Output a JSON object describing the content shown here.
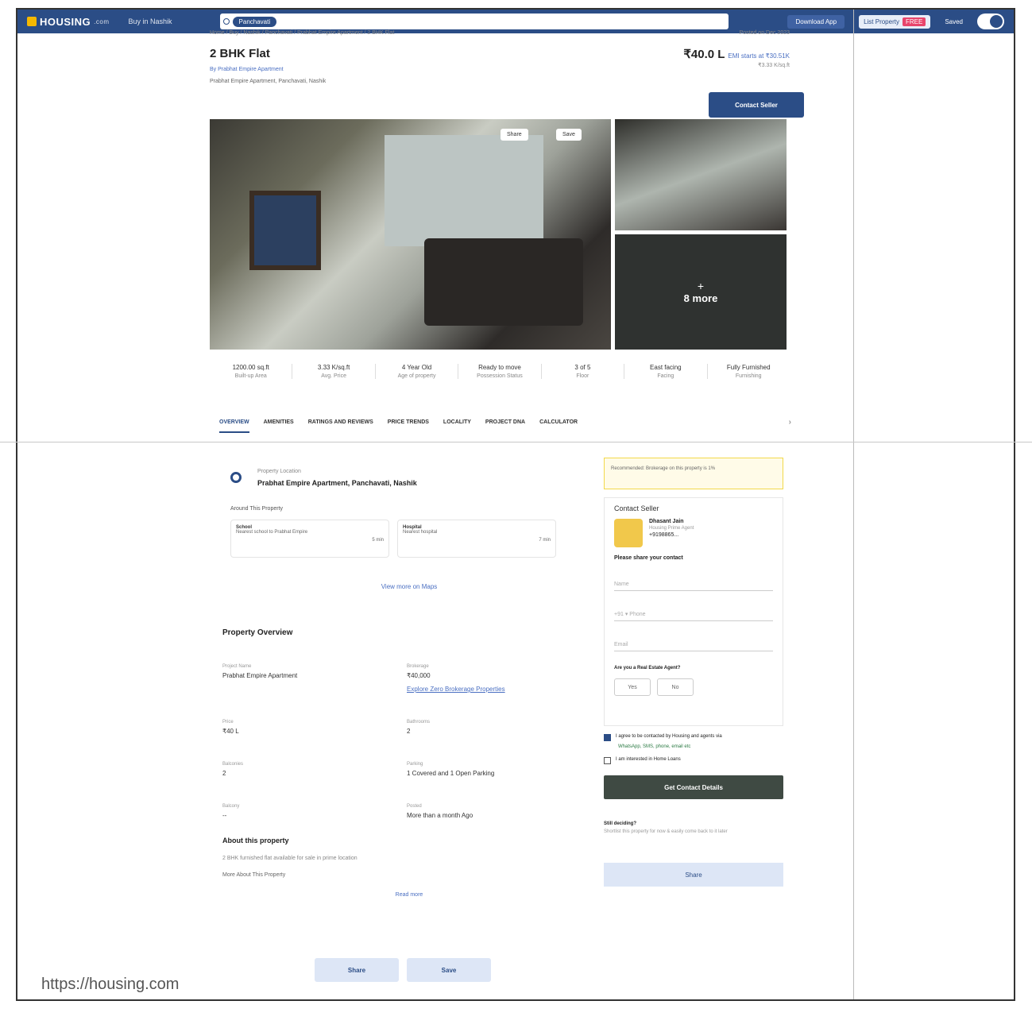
{
  "header": {
    "logo": "HOUSING",
    "logo_suffix": ".com",
    "buy_menu": "Buy in Nashik",
    "search_chip": "Panchavati",
    "download": "Download App",
    "post_property": "List Property",
    "free_badge": "FREE",
    "saved": "Saved"
  },
  "breadcrumb": "Home / Buy / Nashik / Panchavati / Prabhat Empire Apartment / 2 BHK Flat",
  "posted": "Posted on Dec 2023",
  "listing": {
    "title": "2 BHK Flat",
    "by": "By Prabhat Empire Apartment",
    "address": "Prabhat Empire Apartment, Panchavati, Nashik",
    "price": "₹40.0 L",
    "emi": "EMI starts at ₹30.51K",
    "per_sqft": "₹3.33 K/sq.ft",
    "contact_button": "Contact Seller",
    "share": "Share",
    "save": "Save",
    "more_photos": "8 more",
    "more_plus": "+"
  },
  "stats": [
    {
      "value": "1200.00 sq.ft",
      "label": "Built-up Area"
    },
    {
      "value": "3.33 K/sq.ft",
      "label": "Avg. Price"
    },
    {
      "value": "4 Year Old",
      "label": "Age of property"
    },
    {
      "value": "Ready to move",
      "label": "Possession Status"
    },
    {
      "value": "3 of 5",
      "label": "Floor"
    },
    {
      "value": "East facing",
      "label": "Facing"
    },
    {
      "value": "Fully Furnished",
      "label": "Furnishing"
    }
  ],
  "tabs": [
    "OVERVIEW",
    "AMENITIES",
    "RATINGS AND REVIEWS",
    "PRICE TRENDS",
    "LOCALITY",
    "PROJECT DNA",
    "CALCULATOR"
  ],
  "location": {
    "label": "Property Location",
    "value": "Prabhat Empire Apartment, Panchavati, Nashik",
    "around_label": "Around This Property",
    "cards": [
      {
        "title": "School",
        "desc": "Nearest school to Prabhat Empire",
        "time": "5 min"
      },
      {
        "title": "Hospital",
        "desc": "Nearest hospital",
        "time": "7 min"
      }
    ],
    "map_link": "View more on Maps"
  },
  "overview": {
    "title": "Property Overview",
    "items": [
      {
        "label": "Project Name",
        "value": "Prabhat Empire Apartment"
      },
      {
        "label": "Brokerage",
        "value": "₹40,000"
      },
      {
        "label": "Price",
        "value": "₹40 L"
      },
      {
        "label": "Bathrooms",
        "value": "2"
      },
      {
        "label": "Balconies",
        "value": "2"
      },
      {
        "label": "Parking",
        "value": "1 Covered and 1 Open Parking"
      },
      {
        "label": "Balcony",
        "value": "--"
      },
      {
        "label": "Posted",
        "value": "More than a month Ago"
      }
    ],
    "brokerage_link": "Explore Zero Brokerage Properties",
    "about_title": "About this property",
    "about_text": "2 BHK furnished flat available for sale in prime location",
    "about_more": "More About This Property",
    "read_more": "Read more"
  },
  "seller": {
    "alert": "Recommended: Brokerage on this property is 1%",
    "title": "Contact Seller",
    "name": "Dhasant Jain",
    "role": "Housing Prime Agent",
    "phone": "+9198865...",
    "prompt": "Please share your contact",
    "name_field": "Name",
    "phone_field": "+91 ▾ Phone",
    "email_field": "Email",
    "agent_q": "Are you a Real Estate Agent?",
    "yes": "Yes",
    "no": "No",
    "agree": "I agree to be contacted by Housing and agents via",
    "wa": "WhatsApp, SMS, phone, email etc",
    "interested": "I am interested in Home Loans",
    "get_button": "Get Contact Details",
    "still_q": "Still deciding?",
    "still_sub": "Shortlist this property for now & easily come back to it later",
    "share": "Share"
  },
  "bottom": {
    "share": "Share",
    "save": "Save"
  },
  "url": "https://housing.com"
}
